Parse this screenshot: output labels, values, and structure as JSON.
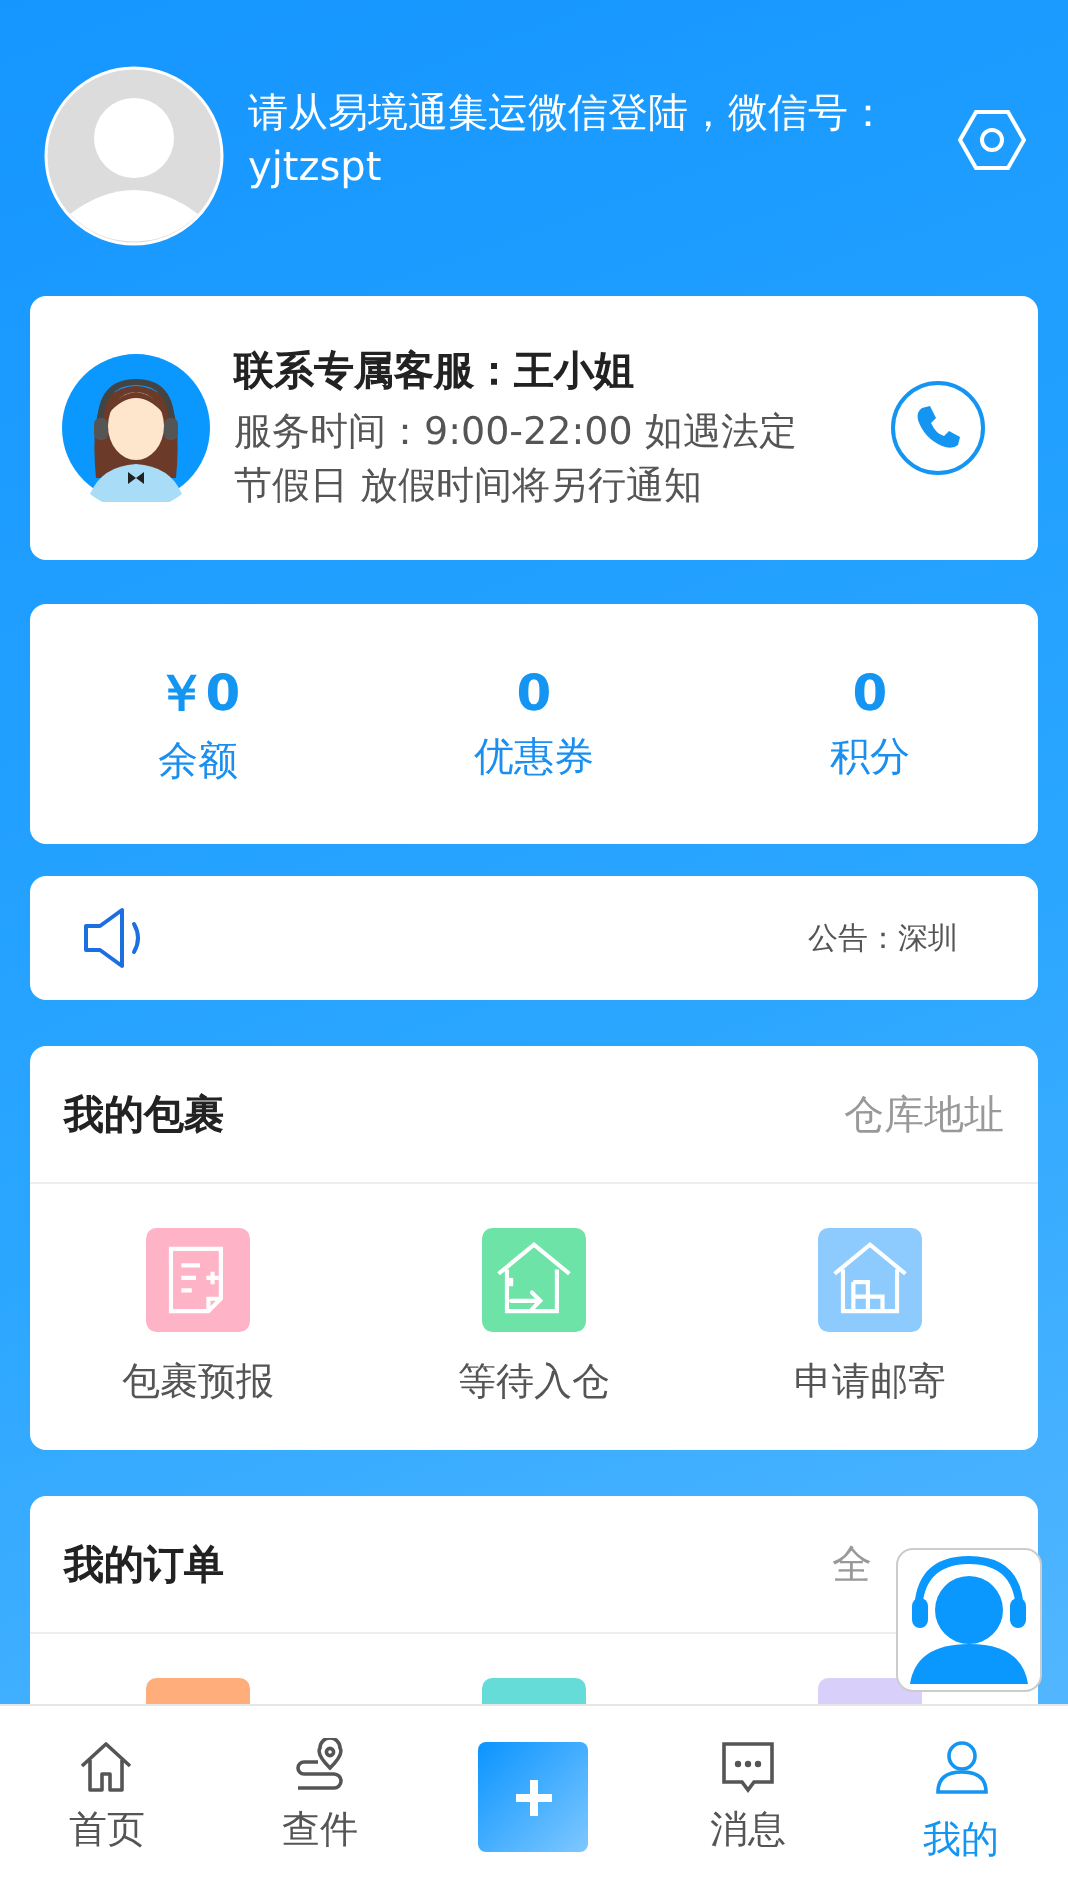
{
  "profile": {
    "login_hint": "请从易境通集运微信登陆，微信号：yjtzspt"
  },
  "service": {
    "title": "联系专属客服：王小姐",
    "hours": "服务时间：9:00-22:00 如遇法定节假日 放假时间将另行通知"
  },
  "stats": [
    {
      "value": "￥0",
      "label": "余额"
    },
    {
      "value": "0",
      "label": "优惠券"
    },
    {
      "value": "0",
      "label": "积分"
    }
  ],
  "notice": {
    "text": "公告：深圳"
  },
  "packages": {
    "title": "我的包裹",
    "link": "仓库地址",
    "items": [
      {
        "label": "包裹预报",
        "color": "#ffb3c6"
      },
      {
        "label": "等待入仓",
        "color": "#6ee3a8"
      },
      {
        "label": "申请邮寄",
        "color": "#8dcbff"
      }
    ]
  },
  "orders": {
    "title": "我的订单",
    "link": "全",
    "items": [
      {
        "color": "#ffad7a"
      },
      {
        "color": "#66dcd8"
      },
      {
        "color": "#d8d0fb"
      }
    ]
  },
  "tabs": [
    {
      "kind": "tab",
      "label": "首页",
      "selected": false
    },
    {
      "kind": "tab",
      "label": "查件",
      "selected": false
    },
    {
      "kind": "add",
      "selected": false
    },
    {
      "kind": "tab",
      "label": "消息",
      "selected": false
    },
    {
      "kind": "tab",
      "label": "我的",
      "selected": true
    }
  ]
}
